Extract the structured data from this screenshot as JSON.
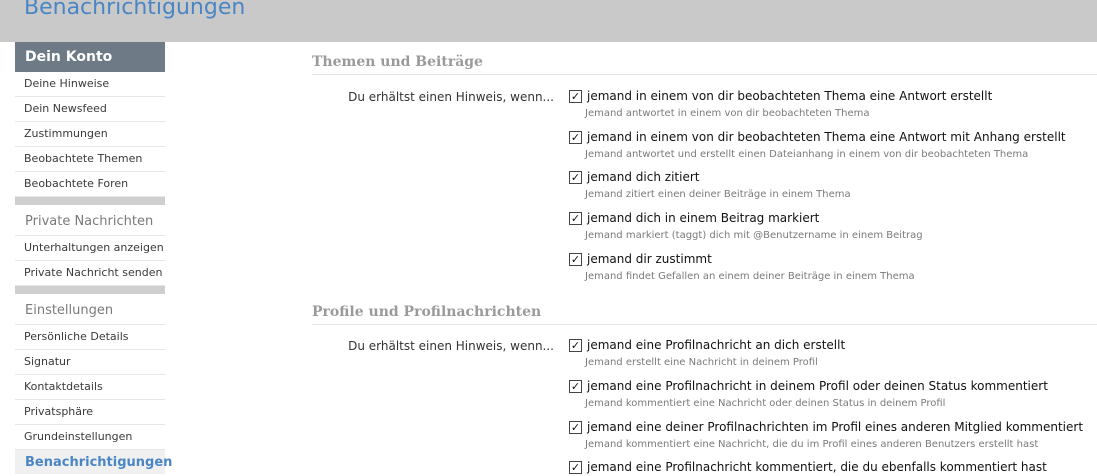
{
  "header": {
    "title": "Benachrichtigungen"
  },
  "sidebar": {
    "heading": "Dein Konto",
    "account_items": [
      "Deine Hinweise",
      "Dein Newsfeed",
      "Zustimmungen",
      "Beobachtete Themen",
      "Beobachtete Foren"
    ],
    "messages_group": "Private Nachrichten",
    "messages_items": [
      "Unterhaltungen anzeigen",
      "Private Nachricht senden"
    ],
    "settings_group": "Einstellungen",
    "settings_items": [
      "Persönliche Details",
      "Signatur",
      "Kontaktdetails",
      "Privatsphäre",
      "Grundeinstellungen"
    ],
    "active_item": "Benachrichtigungen"
  },
  "sections": [
    {
      "title": "Themen und Beiträge",
      "label": "Du erhältst einen Hinweis, wenn...",
      "options": [
        {
          "label": "jemand in einem von dir beobachteten Thema eine Antwort erstellt",
          "hint": "Jemand antwortet in einem von dir beobachteten Thema",
          "checked": true
        },
        {
          "label": "jemand in einem von dir beobachteten Thema eine Antwort mit Anhang erstellt",
          "hint": "Jemand antwortet und erstellt einen Dateianhang in einem von dir beobachteten Thema",
          "checked": true
        },
        {
          "label": "jemand dich zitiert",
          "hint": "Jemand zitiert einen deiner Beiträge in einem Thema",
          "checked": true
        },
        {
          "label": "jemand dich in einem Beitrag markiert",
          "hint": "Jemand markiert (taggt) dich mit @Benutzername in einem Beitrag",
          "checked": true
        },
        {
          "label": "jemand dir zustimmt",
          "hint": "Jemand findet Gefallen an einem deiner Beiträge in einem Thema",
          "checked": true
        }
      ]
    },
    {
      "title": "Profile und Profilnachrichten",
      "label": "Du erhältst einen Hinweis, wenn...",
      "options": [
        {
          "label": "jemand eine Profilnachricht an dich erstellt",
          "hint": "Jemand erstellt eine Nachricht in deinem Profil",
          "checked": true
        },
        {
          "label": "jemand eine Profilnachricht in deinem Profil oder deinen Status kommentiert",
          "hint": "Jemand kommentiert eine Nachricht oder deinen Status in deinem Profil",
          "checked": true
        },
        {
          "label": "jemand eine deiner Profilnachrichten im Profil eines anderen Mitglied kommentiert",
          "hint": "Jemand kommentiert eine Nachricht, die du im Profil eines anderen Benutzers erstellt hast",
          "checked": true
        },
        {
          "label": "jemand eine Profilnachricht kommentiert, die du ebenfalls kommentiert hast",
          "hint": "",
          "checked": true
        }
      ]
    }
  ]
}
